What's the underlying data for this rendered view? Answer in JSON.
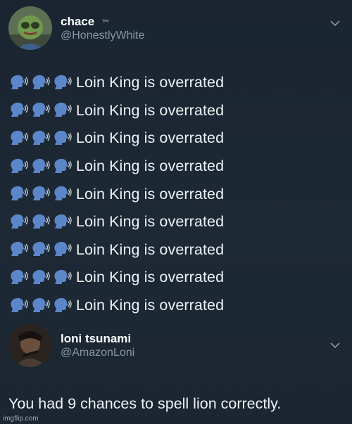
{
  "tweet1": {
    "display_name": "chace",
    "handle": "@HonestlyWhite",
    "lines": [
      {
        "emojis": [
          "speaking-head-icon",
          "speaking-head-icon",
          "speaking-head-icon"
        ],
        "text": "Loin King is overrated"
      },
      {
        "emojis": [
          "speaking-head-icon",
          "speaking-head-icon",
          "speaking-head-icon"
        ],
        "text": "Loin King is overrated"
      },
      {
        "emojis": [
          "speaking-head-icon",
          "speaking-head-icon",
          "speaking-head-icon"
        ],
        "text": "Loin King is overrated"
      },
      {
        "emojis": [
          "speaking-head-icon",
          "speaking-head-icon",
          "speaking-head-icon"
        ],
        "text": "Loin King is overrated"
      },
      {
        "emojis": [
          "speaking-head-icon",
          "speaking-head-icon",
          "speaking-head-icon"
        ],
        "text": "Loin King is overrated"
      },
      {
        "emojis": [
          "speaking-head-icon",
          "speaking-head-icon",
          "speaking-head-icon"
        ],
        "text": "Loin King is overrated"
      },
      {
        "emojis": [
          "speaking-head-icon",
          "speaking-head-icon",
          "speaking-head-icon"
        ],
        "text": "Loin King is overrated"
      },
      {
        "emojis": [
          "speaking-head-icon",
          "speaking-head-icon",
          "speaking-head-icon"
        ],
        "text": "Loin King is overrated"
      },
      {
        "emojis": [
          "speaking-head-icon",
          "speaking-head-icon",
          "speaking-head-icon"
        ],
        "text": "Loin King is overrated"
      }
    ]
  },
  "tweet2": {
    "display_name": "loni tsunami",
    "handle": "@AmazonLoni",
    "body": "You had 9 chances to spell lion correctly."
  },
  "watermark": "imgflip.com",
  "colors": {
    "background": "#1b2733",
    "handle": "#8899a6",
    "text": "#eef2f5",
    "emoji": "#5b86c9"
  }
}
